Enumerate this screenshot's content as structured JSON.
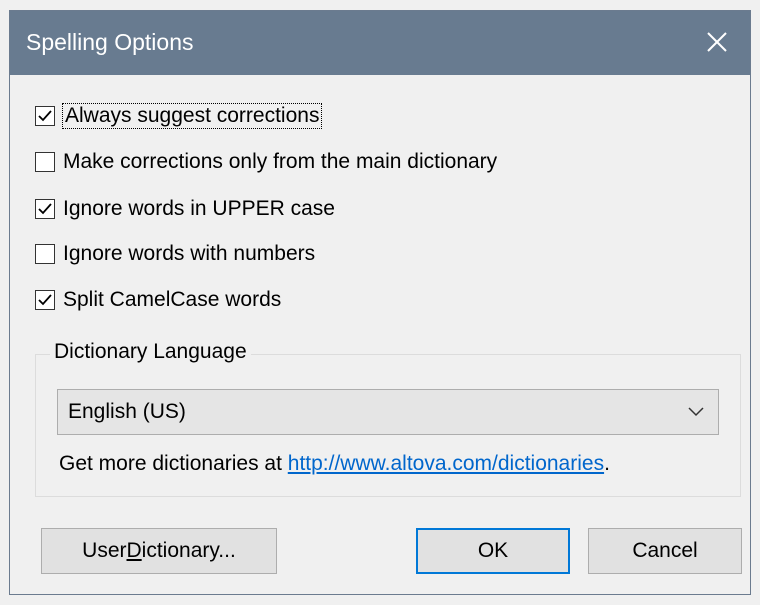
{
  "dialog": {
    "title": "Spelling Options",
    "close_icon": "close-icon"
  },
  "options": [
    {
      "label": "Always suggest corrections",
      "checked": true
    },
    {
      "label": "Make corrections only from the main dictionary",
      "checked": false
    },
    {
      "label": "Ignore words in UPPER case",
      "checked": true
    },
    {
      "label": "Ignore words with numbers",
      "checked": false
    },
    {
      "label": "Split CamelCase words",
      "checked": true
    }
  ],
  "dictionary_language": {
    "group_label": "Dictionary Language",
    "selected": "English (US)",
    "more_prefix": "Get more dictionaries at ",
    "more_link": "http://www.altova.com/dictionaries",
    "more_suffix": "."
  },
  "buttons": {
    "user_dictionary_pre": "User ",
    "user_dictionary_accel": "D",
    "user_dictionary_post": "ictionary...",
    "ok": "OK",
    "cancel": "Cancel"
  },
  "colors": {
    "titlebar": "#687b90",
    "link": "#0066cc",
    "default_button_border": "#0078d7"
  }
}
